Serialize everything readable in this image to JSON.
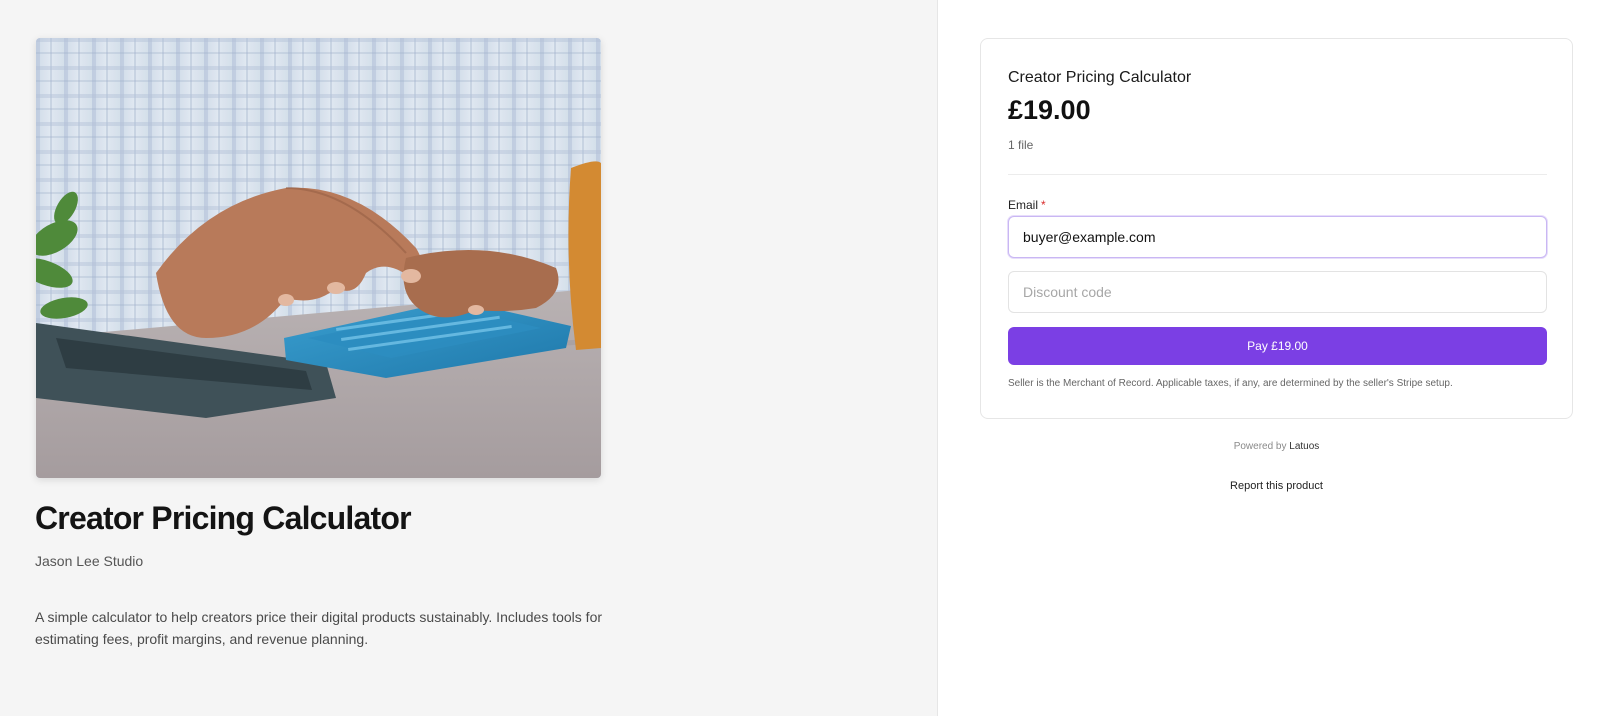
{
  "product": {
    "title": "Creator Pricing Calculator",
    "creator": "Jason Lee Studio",
    "description": "A simple calculator to help creators price their digital products sustainably. Includes tools for estimating fees, profit margins, and revenue planning."
  },
  "checkout": {
    "title": "Creator Pricing Calculator",
    "price": "£19.00",
    "file_count": "1 file",
    "email_label": "Email",
    "required_mark": "*",
    "email_value": "buyer@example.com",
    "discount_placeholder": "Discount code",
    "pay_label": "Pay £19.00",
    "merchant_note": "Seller is the Merchant of Record. Applicable taxes, if any, are determined by the seller's Stripe setup."
  },
  "footer": {
    "powered_prefix": "Powered by",
    "powered_brand": "Latuos",
    "report_label": "Report this product"
  },
  "colors": {
    "accent": "#7b3fe4",
    "left_panel_bg": "#f5f5f5"
  }
}
